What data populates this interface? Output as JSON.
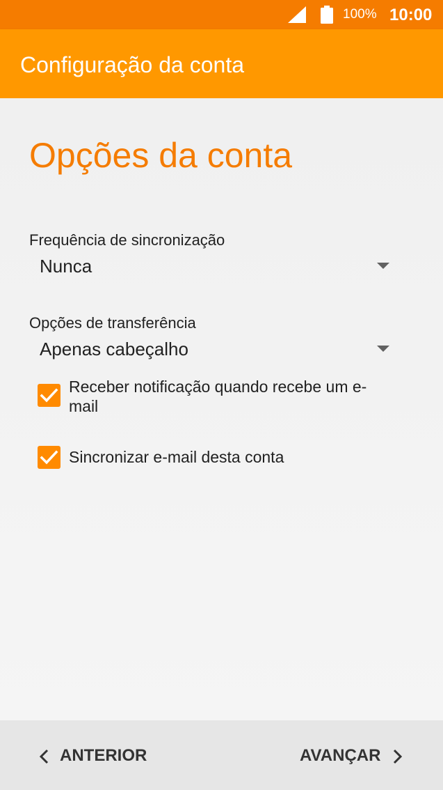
{
  "status_bar": {
    "battery": "100%",
    "time": "10:00",
    "signal_icon": "cell-signal-icon",
    "battery_icon": "battery-full-icon"
  },
  "app_bar": {
    "title": "Configuração da conta"
  },
  "page": {
    "heading": "Opções da conta",
    "sync_frequency": {
      "label": "Frequência de sincronização",
      "value": "Nunca"
    },
    "transfer_options": {
      "label": "Opções de transferência",
      "value": "Apenas cabeçalho"
    },
    "checkboxes": [
      {
        "label": "Receber notificação quando recebe um e-mail",
        "checked": true
      },
      {
        "label": "Sincronizar e-mail desta conta",
        "checked": true
      }
    ]
  },
  "nav": {
    "previous_label": "ANTERIOR",
    "next_label": "AVANÇAR"
  },
  "colors": {
    "status_bar": "#f57c00",
    "app_bar": "#ff9800",
    "accent": "#f57c00",
    "checkbox": "#ff8a00"
  }
}
